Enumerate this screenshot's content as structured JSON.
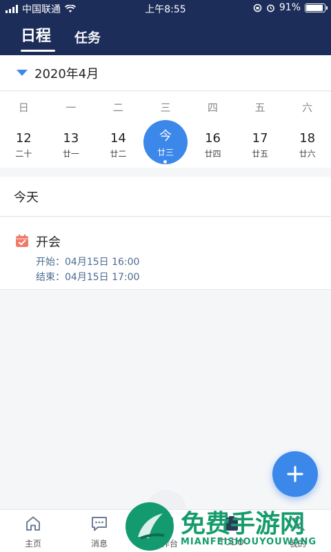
{
  "status_bar": {
    "carrier": "中国联通",
    "time": "上午8:55",
    "battery_percent": "91%",
    "battery_level": 0.91
  },
  "header": {
    "tabs": [
      {
        "label": "日程",
        "active": true
      },
      {
        "label": "任务",
        "active": false
      }
    ]
  },
  "month": {
    "label": "2020年4月",
    "icon": "triangle-down-icon"
  },
  "calendar": {
    "weekdays": [
      "日",
      "一",
      "二",
      "三",
      "四",
      "五",
      "六"
    ],
    "days": [
      {
        "num": "12",
        "lunar": "二十"
      },
      {
        "num": "13",
        "lunar": "廿一"
      },
      {
        "num": "14",
        "lunar": "廿二"
      },
      {
        "num": "今",
        "lunar": "廿三",
        "today": true
      },
      {
        "num": "16",
        "lunar": "廿四"
      },
      {
        "num": "17",
        "lunar": "廿五"
      },
      {
        "num": "18",
        "lunar": "廿六"
      }
    ]
  },
  "section": {
    "today_label": "今天"
  },
  "event": {
    "title": "开会",
    "start": "开始：04月15日 16:00",
    "end": "结束：04月15日 17:00",
    "icon": "calendar-check-icon",
    "icon_color": "#f07a6a"
  },
  "fab": {
    "icon": "plus-icon"
  },
  "bottom_nav": {
    "items": [
      {
        "label": "主页",
        "icon": "home-icon"
      },
      {
        "label": "消息",
        "icon": "message-icon"
      },
      {
        "label": "工作台",
        "icon": "workbench-icon"
      },
      {
        "label": "TODO",
        "icon": "todo-icon"
      },
      {
        "label": "我的",
        "icon": "profile-icon"
      }
    ]
  },
  "watermark": {
    "title": "免费手游网",
    "subtitle": "MIANFEISHOUYOUWANG"
  },
  "colors": {
    "header_bg": "#1d2d5a",
    "accent": "#3b87ea",
    "watermark": "#169c6c"
  }
}
